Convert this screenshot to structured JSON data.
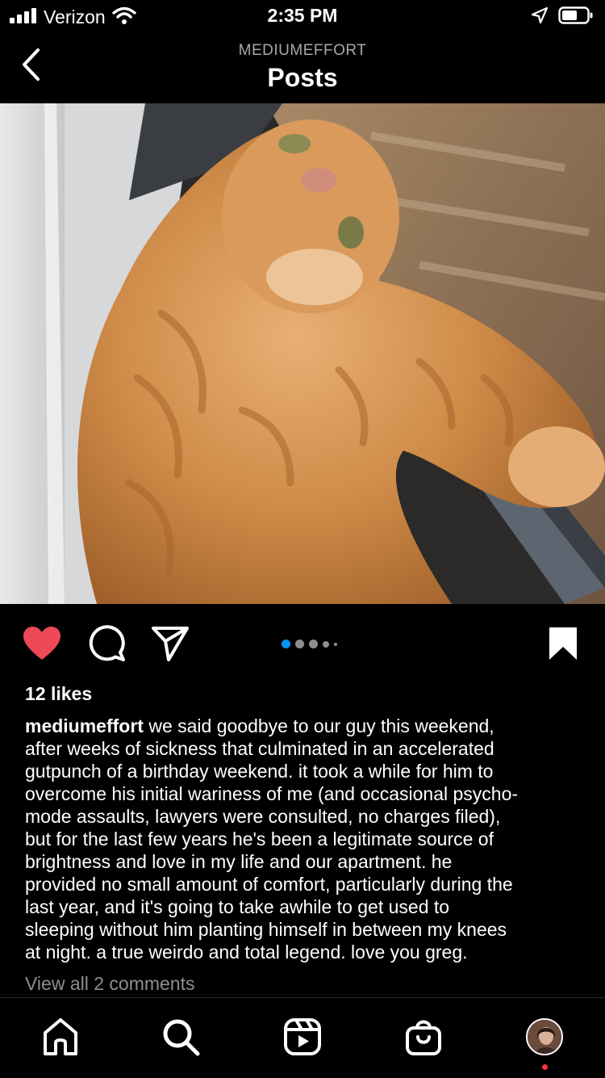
{
  "status_bar": {
    "carrier": "Verizon",
    "time": "2:35 PM"
  },
  "header": {
    "username": "MEDIUMEFFORT",
    "title": "Posts"
  },
  "post": {
    "image_alt": "orange tabby cat lying on its back by a window, paw stretched toward the glass",
    "carousel": {
      "count": 5,
      "active_index": 0
    },
    "liked": true,
    "likes_text": "12 likes",
    "caption_user": "mediumeffort",
    "caption_text": "we said goodbye to our guy this weekend,\nafter weeks of sickness that culminated in an accelerated\ngutpunch of a birthday weekend. it took a while for him to\novercome his initial wariness of me (and occasional psycho-\nmode assaults, lawyers were consulted, no charges filed),\nbut for the last few years he's been a legitimate source of\nbrightness and love in my life and our apartment. he\nprovided no small amount of comfort, particularly during the\nlast year, and it's going to take awhile to get used to\nsleeping without him planting himself in between my knees\nat night. a true weirdo and total legend. love you greg.",
    "view_comments": "View all 2 comments"
  },
  "tab_bar": {
    "items": [
      "home-icon",
      "search-icon",
      "reels-icon",
      "shop-icon",
      "profile-avatar"
    ]
  },
  "colors": {
    "background": "#000000",
    "heart": "#ed4956",
    "carousel_active": "#0095f6",
    "muted_text": "#8e8e8e",
    "notification": "#ff3040"
  }
}
